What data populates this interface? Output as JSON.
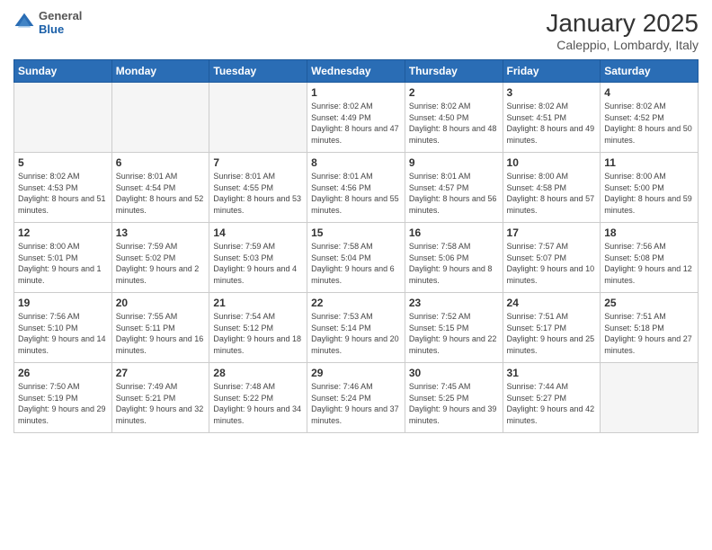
{
  "header": {
    "logo_general": "General",
    "logo_blue": "Blue",
    "month_title": "January 2025",
    "location": "Caleppio, Lombardy, Italy"
  },
  "weekdays": [
    "Sunday",
    "Monday",
    "Tuesday",
    "Wednesday",
    "Thursday",
    "Friday",
    "Saturday"
  ],
  "weeks": [
    [
      {
        "day": "",
        "info": ""
      },
      {
        "day": "",
        "info": ""
      },
      {
        "day": "",
        "info": ""
      },
      {
        "day": "1",
        "info": "Sunrise: 8:02 AM\nSunset: 4:49 PM\nDaylight: 8 hours and 47 minutes."
      },
      {
        "day": "2",
        "info": "Sunrise: 8:02 AM\nSunset: 4:50 PM\nDaylight: 8 hours and 48 minutes."
      },
      {
        "day": "3",
        "info": "Sunrise: 8:02 AM\nSunset: 4:51 PM\nDaylight: 8 hours and 49 minutes."
      },
      {
        "day": "4",
        "info": "Sunrise: 8:02 AM\nSunset: 4:52 PM\nDaylight: 8 hours and 50 minutes."
      }
    ],
    [
      {
        "day": "5",
        "info": "Sunrise: 8:02 AM\nSunset: 4:53 PM\nDaylight: 8 hours and 51 minutes."
      },
      {
        "day": "6",
        "info": "Sunrise: 8:01 AM\nSunset: 4:54 PM\nDaylight: 8 hours and 52 minutes."
      },
      {
        "day": "7",
        "info": "Sunrise: 8:01 AM\nSunset: 4:55 PM\nDaylight: 8 hours and 53 minutes."
      },
      {
        "day": "8",
        "info": "Sunrise: 8:01 AM\nSunset: 4:56 PM\nDaylight: 8 hours and 55 minutes."
      },
      {
        "day": "9",
        "info": "Sunrise: 8:01 AM\nSunset: 4:57 PM\nDaylight: 8 hours and 56 minutes."
      },
      {
        "day": "10",
        "info": "Sunrise: 8:00 AM\nSunset: 4:58 PM\nDaylight: 8 hours and 57 minutes."
      },
      {
        "day": "11",
        "info": "Sunrise: 8:00 AM\nSunset: 5:00 PM\nDaylight: 8 hours and 59 minutes."
      }
    ],
    [
      {
        "day": "12",
        "info": "Sunrise: 8:00 AM\nSunset: 5:01 PM\nDaylight: 9 hours and 1 minute."
      },
      {
        "day": "13",
        "info": "Sunrise: 7:59 AM\nSunset: 5:02 PM\nDaylight: 9 hours and 2 minutes."
      },
      {
        "day": "14",
        "info": "Sunrise: 7:59 AM\nSunset: 5:03 PM\nDaylight: 9 hours and 4 minutes."
      },
      {
        "day": "15",
        "info": "Sunrise: 7:58 AM\nSunset: 5:04 PM\nDaylight: 9 hours and 6 minutes."
      },
      {
        "day": "16",
        "info": "Sunrise: 7:58 AM\nSunset: 5:06 PM\nDaylight: 9 hours and 8 minutes."
      },
      {
        "day": "17",
        "info": "Sunrise: 7:57 AM\nSunset: 5:07 PM\nDaylight: 9 hours and 10 minutes."
      },
      {
        "day": "18",
        "info": "Sunrise: 7:56 AM\nSunset: 5:08 PM\nDaylight: 9 hours and 12 minutes."
      }
    ],
    [
      {
        "day": "19",
        "info": "Sunrise: 7:56 AM\nSunset: 5:10 PM\nDaylight: 9 hours and 14 minutes."
      },
      {
        "day": "20",
        "info": "Sunrise: 7:55 AM\nSunset: 5:11 PM\nDaylight: 9 hours and 16 minutes."
      },
      {
        "day": "21",
        "info": "Sunrise: 7:54 AM\nSunset: 5:12 PM\nDaylight: 9 hours and 18 minutes."
      },
      {
        "day": "22",
        "info": "Sunrise: 7:53 AM\nSunset: 5:14 PM\nDaylight: 9 hours and 20 minutes."
      },
      {
        "day": "23",
        "info": "Sunrise: 7:52 AM\nSunset: 5:15 PM\nDaylight: 9 hours and 22 minutes."
      },
      {
        "day": "24",
        "info": "Sunrise: 7:51 AM\nSunset: 5:17 PM\nDaylight: 9 hours and 25 minutes."
      },
      {
        "day": "25",
        "info": "Sunrise: 7:51 AM\nSunset: 5:18 PM\nDaylight: 9 hours and 27 minutes."
      }
    ],
    [
      {
        "day": "26",
        "info": "Sunrise: 7:50 AM\nSunset: 5:19 PM\nDaylight: 9 hours and 29 minutes."
      },
      {
        "day": "27",
        "info": "Sunrise: 7:49 AM\nSunset: 5:21 PM\nDaylight: 9 hours and 32 minutes."
      },
      {
        "day": "28",
        "info": "Sunrise: 7:48 AM\nSunset: 5:22 PM\nDaylight: 9 hours and 34 minutes."
      },
      {
        "day": "29",
        "info": "Sunrise: 7:46 AM\nSunset: 5:24 PM\nDaylight: 9 hours and 37 minutes."
      },
      {
        "day": "30",
        "info": "Sunrise: 7:45 AM\nSunset: 5:25 PM\nDaylight: 9 hours and 39 minutes."
      },
      {
        "day": "31",
        "info": "Sunrise: 7:44 AM\nSunset: 5:27 PM\nDaylight: 9 hours and 42 minutes."
      },
      {
        "day": "",
        "info": ""
      }
    ]
  ]
}
